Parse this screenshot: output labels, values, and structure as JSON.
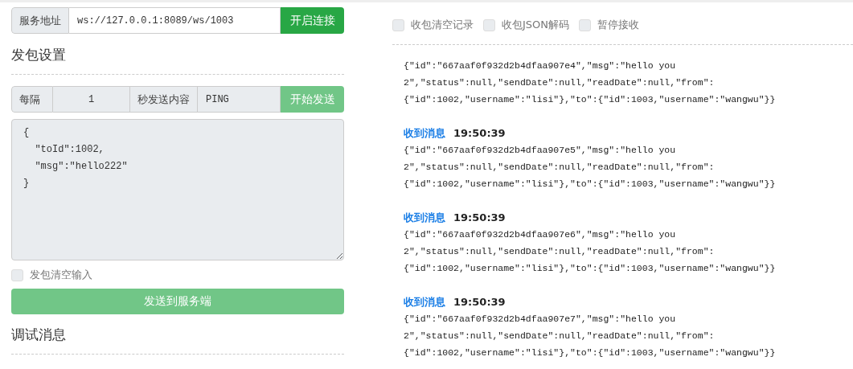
{
  "connection": {
    "label": "服务地址",
    "url": "ws://127.0.0.1:8089/ws/1003",
    "button": {
      "label": "开启连接",
      "disabled": false
    }
  },
  "send_settings": {
    "title": "发包设置",
    "interval": {
      "prefix": "每隔",
      "value": "1",
      "suffix": "秒发送内容",
      "content": "PING",
      "button": {
        "label": "开始发送",
        "disabled": true
      }
    },
    "payload": {
      "lines": [
        "{",
        "  \"toId\":1002,",
        "  \"msg\":\"hello222\"",
        "}"
      ],
      "disabled": true
    },
    "clear_input": {
      "label": "发包清空输入",
      "checked": false
    },
    "send_button": {
      "label": "发送到服务端",
      "disabled": true
    }
  },
  "debug": {
    "title": "调试消息"
  },
  "receive_options": [
    {
      "label": "收包清空记录",
      "checked": false
    },
    {
      "label": "收包JSON解码",
      "checked": false
    },
    {
      "label": "暂停接收",
      "checked": false
    }
  ],
  "messages": [
    {
      "lines": [
        "{\"id\":\"667aaf0f932d2b4dfaa907e4\",\"msg\":\"hello you",
        "2\",\"status\":null,\"sendDate\":null,\"readDate\":null,\"from\":",
        "{\"id\":1002,\"username\":\"lisi\"},\"to\":{\"id\":1003,\"username\":\"wangwu\"}}"
      ]
    },
    {
      "label": "收到消息",
      "time": "19:50:39",
      "lines": [
        "{\"id\":\"667aaf0f932d2b4dfaa907e5\",\"msg\":\"hello you",
        "2\",\"status\":null,\"sendDate\":null,\"readDate\":null,\"from\":",
        "{\"id\":1002,\"username\":\"lisi\"},\"to\":{\"id\":1003,\"username\":\"wangwu\"}}"
      ]
    },
    {
      "label": "收到消息",
      "time": "19:50:39",
      "lines": [
        "{\"id\":\"667aaf0f932d2b4dfaa907e6\",\"msg\":\"hello you",
        "2\",\"status\":null,\"sendDate\":null,\"readDate\":null,\"from\":",
        "{\"id\":1002,\"username\":\"lisi\"},\"to\":{\"id\":1003,\"username\":\"wangwu\"}}"
      ]
    },
    {
      "label": "收到消息",
      "time": "19:50:39",
      "lines": [
        "{\"id\":\"667aaf0f932d2b4dfaa907e7\",\"msg\":\"hello you",
        "2\",\"status\":null,\"sendDate\":null,\"readDate\":null,\"from\":",
        "{\"id\":1002,\"username\":\"lisi\"},\"to\":{\"id\":1003,\"username\":\"wangwu\"}}"
      ]
    }
  ]
}
